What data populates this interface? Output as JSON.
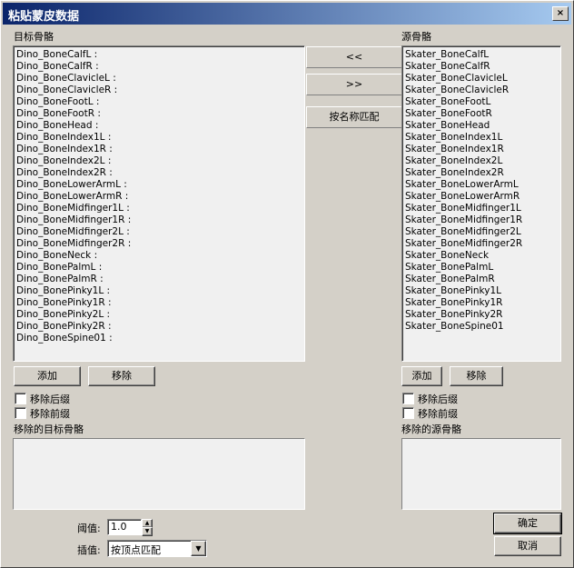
{
  "window": {
    "title": "粘贴蒙皮数据",
    "close_glyph": "×"
  },
  "target": {
    "label": "目标骨骼",
    "items": [
      "Dino_BoneCalfL :",
      "Dino_BoneCalfR :",
      "Dino_BoneClavicleL :",
      "Dino_BoneClavicleR :",
      "Dino_BoneFootL :",
      "Dino_BoneFootR :",
      "Dino_BoneHead :",
      "Dino_BoneIndex1L :",
      "Dino_BoneIndex1R :",
      "Dino_BoneIndex2L :",
      "Dino_BoneIndex2R :",
      "Dino_BoneLowerArmL :",
      "Dino_BoneLowerArmR :",
      "Dino_BoneMidfinger1L :",
      "Dino_BoneMidfinger1R :",
      "Dino_BoneMidfinger2L :",
      "Dino_BoneMidfinger2R :",
      "Dino_BoneNeck :",
      "Dino_BonePalmL :",
      "Dino_BonePalmR :",
      "Dino_BonePinky1L :",
      "Dino_BonePinky1R :",
      "Dino_BonePinky2L :",
      "Dino_BonePinky2R :",
      "Dino_BoneSpine01 :"
    ],
    "add_label": "添加",
    "remove_label": "移除",
    "remove_suffix_label": "移除后缀",
    "remove_prefix_label": "移除前缀",
    "removed_label": "移除的目标骨骼"
  },
  "source": {
    "label": "源骨骼",
    "items": [
      "Skater_BoneCalfL",
      "Skater_BoneCalfR",
      "Skater_BoneClavicleL",
      "Skater_BoneClavicleR",
      "Skater_BoneFootL",
      "Skater_BoneFootR",
      "Skater_BoneHead",
      "Skater_BoneIndex1L",
      "Skater_BoneIndex1R",
      "Skater_BoneIndex2L",
      "Skater_BoneIndex2R",
      "Skater_BoneLowerArmL",
      "Skater_BoneLowerArmR",
      "Skater_BoneMidfinger1L",
      "Skater_BoneMidfinger1R",
      "Skater_BoneMidfinger2L",
      "Skater_BoneMidfinger2R",
      "Skater_BoneNeck",
      "Skater_BonePalmL",
      "Skater_BonePalmR",
      "Skater_BonePinky1L",
      "Skater_BonePinky1R",
      "Skater_BonePinky2R",
      "Skater_BoneSpine01"
    ],
    "add_label": "添加",
    "remove_label": "移除",
    "remove_suffix_label": "移除后缀",
    "remove_prefix_label": "移除前缀",
    "removed_label": "移除的源骨骼"
  },
  "middle": {
    "move_left": "<<",
    "move_right": ">>",
    "match_by_name": "按名称匹配"
  },
  "bottom": {
    "threshold_label": "阈值:",
    "threshold_value": "1.0",
    "interp_label": "插值:",
    "interp_value": "按顶点匹配",
    "ok_label": "确定",
    "cancel_label": "取消",
    "spin_up": "▲",
    "spin_down": "▼",
    "dropdown_arrow": "▼"
  }
}
